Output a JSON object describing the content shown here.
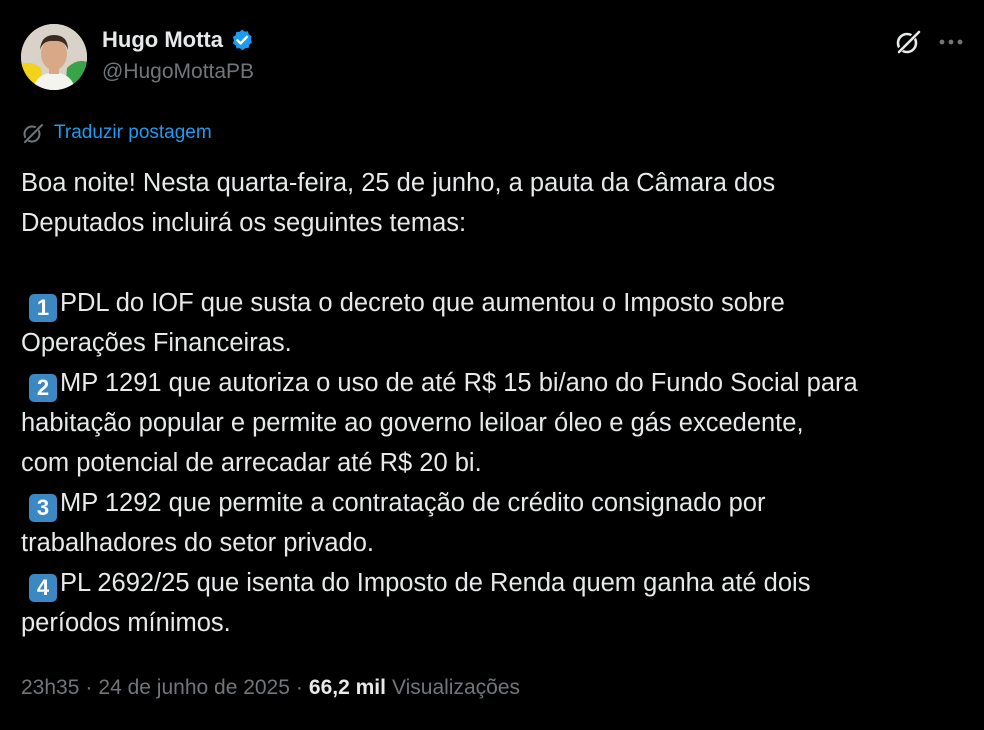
{
  "author": {
    "display_name": "Hugo Motta",
    "handle": "@HugoMottaPB",
    "verified_color": "#1d9bf0"
  },
  "header_icons": {
    "grok": "grok-icon",
    "more": "more-options-icon"
  },
  "translate": {
    "icon": "translate-icon",
    "label": "Traduzir postagem"
  },
  "tweet": {
    "intro": [
      "Boa noite! Nesta quarta-feira, 25 de junho, a pauta da Câmara dos",
      "Deputados incluirá os seguintes temas:"
    ],
    "items": [
      {
        "keycap": "1",
        "lines": [
          "PDL do IOF que susta o decreto que aumentou o Imposto sobre",
          "Operações Financeiras."
        ]
      },
      {
        "keycap": "2",
        "lines": [
          "MP 1291 que autoriza o uso de até R$ 15 bi/ano do Fundo Social para",
          "habitação popular e permite ao governo leiloar óleo e gás excedente,",
          "com potencial de arrecadar até R$ 20 bi."
        ]
      },
      {
        "keycap": "3",
        "lines": [
          "MP 1292 que permite a contratação de crédito consignado por",
          "trabalhadores do setor privado."
        ]
      },
      {
        "keycap": "4",
        "lines": [
          "PL 2692/25 que isenta do Imposto de Renda quem ganha até dois",
          "períodos mínimos."
        ]
      }
    ]
  },
  "meta": {
    "time": "23h35",
    "separator": "·",
    "date": "24 de junho de 2025",
    "views_count": "66,2 mil",
    "views_label": "Visualizações"
  },
  "colors": {
    "background": "#000000",
    "text_primary": "#e7e9ea",
    "text_secondary": "#71767b",
    "link": "#1d9bf0",
    "keycap": "#3b88c3"
  }
}
